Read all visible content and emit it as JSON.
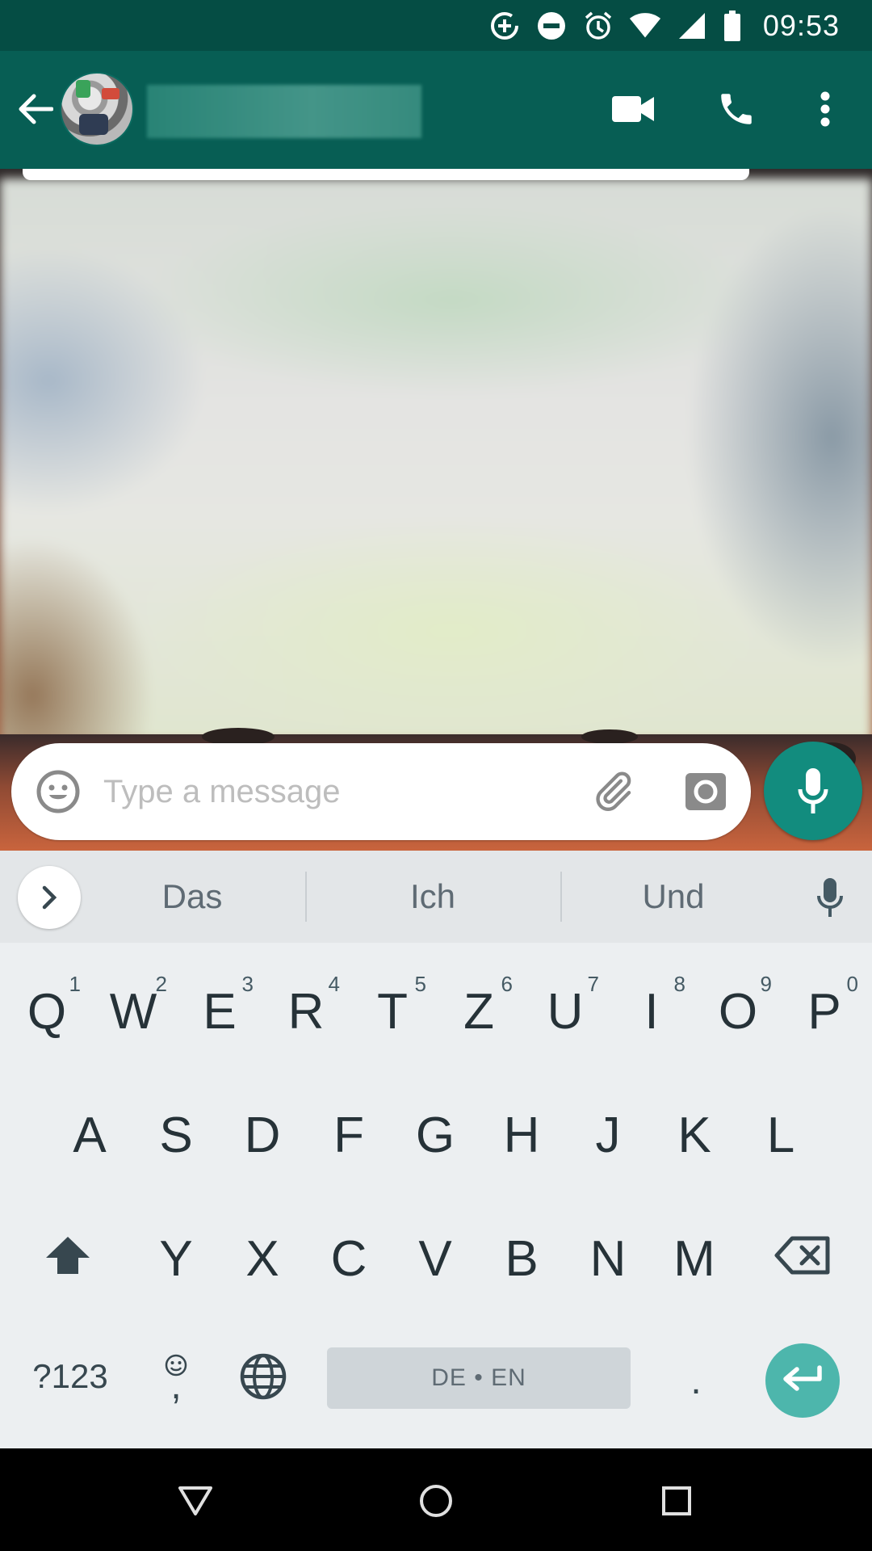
{
  "status_bar": {
    "time": "09:53",
    "icons": [
      "data-saver-icon",
      "do-not-disturb-icon",
      "alarm-icon",
      "wifi-icon",
      "cell-signal-icon",
      "battery-icon"
    ]
  },
  "app_bar": {
    "contact_name": "",
    "actions": [
      "video-call-icon",
      "voice-call-icon",
      "more-options-icon"
    ]
  },
  "composer": {
    "placeholder": "Type a message",
    "value": ""
  },
  "keyboard": {
    "suggestions": [
      "Das",
      "Ich",
      "Und"
    ],
    "row1": [
      {
        "k": "Q",
        "h": "1"
      },
      {
        "k": "W",
        "h": "2"
      },
      {
        "k": "E",
        "h": "3"
      },
      {
        "k": "R",
        "h": "4"
      },
      {
        "k": "T",
        "h": "5"
      },
      {
        "k": "Z",
        "h": "6"
      },
      {
        "k": "U",
        "h": "7"
      },
      {
        "k": "I",
        "h": "8"
      },
      {
        "k": "O",
        "h": "9"
      },
      {
        "k": "P",
        "h": "0"
      }
    ],
    "row2": [
      "A",
      "S",
      "D",
      "F",
      "G",
      "H",
      "J",
      "K",
      "L"
    ],
    "row3": [
      "Y",
      "X",
      "C",
      "V",
      "B",
      "N",
      "M"
    ],
    "symbols_label": "?123",
    "comma_label": ",",
    "space_label": "DE • EN",
    "period_label": "."
  },
  "colors": {
    "status_bar": "#054d44",
    "app_bar": "#075e54",
    "accent": "#128c7e",
    "enter_key": "#4db6ac",
    "keyboard_bg": "#eceff1"
  }
}
